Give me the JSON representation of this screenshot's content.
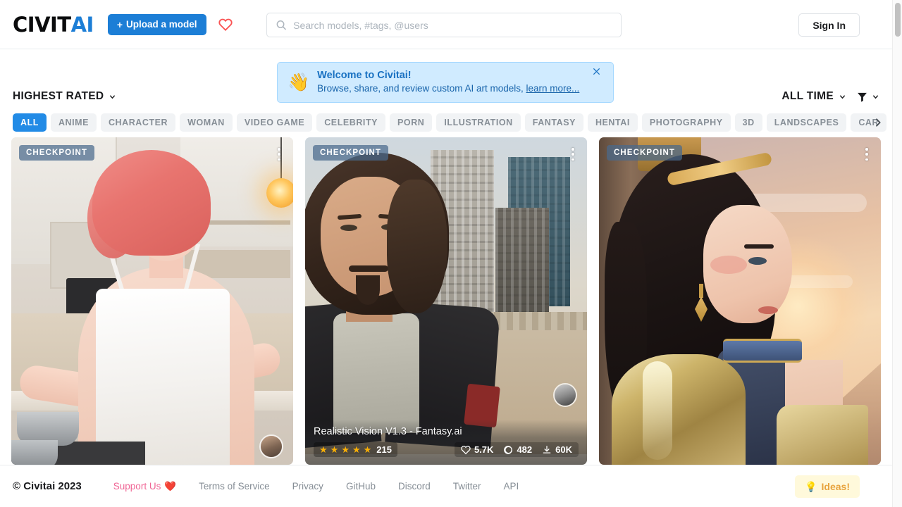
{
  "header": {
    "logo_civit": "CIVIT",
    "logo_ai": "AI",
    "upload_plus": "+",
    "upload_label": "Upload a model",
    "heart_icon": "heart-outline-icon",
    "search_placeholder": "Search models, #tags, @users",
    "search_value": "",
    "search_icon": "search-icon",
    "signin_label": "Sign In"
  },
  "banner": {
    "emoji": "👋",
    "title": "Welcome to Civitai!",
    "subtitle": "Browse, share, and review custom AI art models,",
    "link": "learn more...",
    "close_icon": "close-icon"
  },
  "filters": {
    "sort_label": "HIGHEST RATED",
    "sort_chevron": "chevron-down-icon",
    "period_label": "ALL TIME",
    "period_chevron": "chevron-down-icon",
    "filter_icon": "funnel-filter-icon",
    "filter_chevron": "chevron-down-icon"
  },
  "tabs": {
    "items": [
      {
        "label": "ALL",
        "active": true
      },
      {
        "label": "ANIME",
        "active": false
      },
      {
        "label": "CHARACTER",
        "active": false
      },
      {
        "label": "WOMAN",
        "active": false
      },
      {
        "label": "VIDEO GAME",
        "active": false
      },
      {
        "label": "CELEBRITY",
        "active": false
      },
      {
        "label": "PORN",
        "active": false
      },
      {
        "label": "ILLUSTRATION",
        "active": false
      },
      {
        "label": "FANTASY",
        "active": false
      },
      {
        "label": "HENTAI",
        "active": false
      },
      {
        "label": "PHOTOGRAPHY",
        "active": false
      },
      {
        "label": "3D",
        "active": false
      },
      {
        "label": "LANDSCAPES",
        "active": false
      },
      {
        "label": "CAR",
        "active": false
      }
    ],
    "next_icon": "chevron-right-icon"
  },
  "cards": [
    {
      "badge": "CHECKPOINT",
      "menu_icon": "more-vertical-icon",
      "title": "",
      "has_footer": false,
      "avatar": "user-avatar",
      "stats": {
        "rating_stars": 0,
        "rating_count": "",
        "likes": "",
        "comments": "",
        "downloads": ""
      }
    },
    {
      "badge": "CHECKPOINT",
      "menu_icon": "more-vertical-icon",
      "title": "Realistic Vision V1.3 - Fantasy.ai",
      "has_footer": true,
      "avatar": "user-avatar",
      "stats": {
        "rating_stars": 5,
        "rating_count": "215",
        "likes": "5.7K",
        "comments": "482",
        "downloads": "60K",
        "like_icon": "heart-outline-icon",
        "comment_icon": "comment-bubble-icon",
        "download_icon": "download-icon"
      }
    },
    {
      "badge": "CHECKPOINT",
      "menu_icon": "more-vertical-icon",
      "title": "",
      "has_footer": false,
      "avatar": "user-avatar",
      "stats": {
        "rating_stars": 0,
        "rating_count": "",
        "likes": "",
        "comments": "",
        "downloads": ""
      }
    }
  ],
  "footer": {
    "copyright": "© Civitai 2023",
    "links": [
      {
        "label": "Support Us",
        "style": "support",
        "icon": "heart-red-icon"
      },
      {
        "label": "Terms of Service",
        "style": "normal"
      },
      {
        "label": "Privacy",
        "style": "normal"
      },
      {
        "label": "GitHub",
        "style": "normal"
      },
      {
        "label": "Discord",
        "style": "normal"
      },
      {
        "label": "Twitter",
        "style": "normal"
      },
      {
        "label": "API",
        "style": "normal"
      }
    ],
    "ideas_icon": "lightbulb-icon",
    "ideas_label": "Ideas!"
  },
  "colors": {
    "brand_blue": "#1c7ed6",
    "tab_active": "#228be6",
    "banner_bg": "#d0ebff",
    "star_gold": "#fab005",
    "support_pink": "#f06595",
    "ideas_bg": "#fff9db",
    "ideas_text": "#e8a33d"
  }
}
